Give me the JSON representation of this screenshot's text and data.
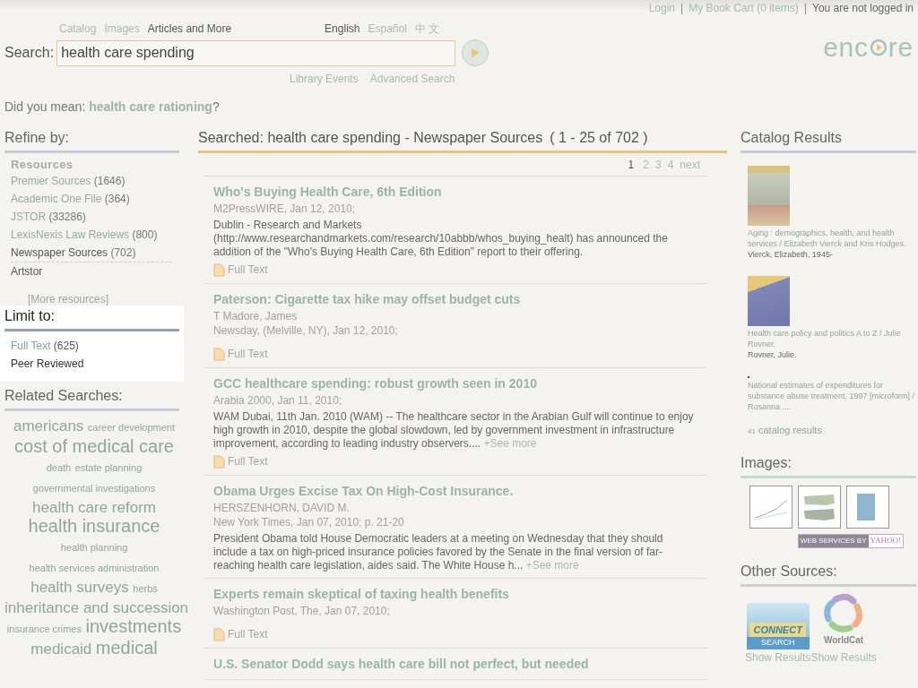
{
  "top_links": [
    {
      "label": "Login"
    },
    {
      "label": "My Book Cart (0 items)"
    }
  ],
  "separator": "|",
  "login_status": "You are not logged in",
  "logo": {
    "text_before": "enc",
    "text_after": "re"
  },
  "search_tabs": [
    {
      "label": "Catalog",
      "selected": false
    },
    {
      "label": "Images",
      "selected": false
    },
    {
      "label": "Articles and More",
      "selected": true
    }
  ],
  "languages": [
    {
      "label": "English",
      "selected": true
    },
    {
      "label": "Español",
      "selected": false
    },
    {
      "label": "中 文",
      "selected": false
    }
  ],
  "search": {
    "label": "Search:",
    "value": "health care spending"
  },
  "search_links": [
    "Library Events",
    "Advanced Search"
  ],
  "did_you_mean": {
    "prefix": "Did you mean:",
    "suggestion": "health care rationing",
    "suffix": "?"
  },
  "refine": {
    "title": "Refine by:",
    "group": "Resources",
    "items": [
      {
        "label": "Premier Sources",
        "count": "(1646)",
        "selected": false,
        "kind": "link"
      },
      {
        "label": "Academic One File",
        "count": "(364)",
        "selected": false,
        "kind": "link"
      },
      {
        "label": "JSTOR",
        "count": "(33286)",
        "selected": false,
        "kind": "link"
      },
      {
        "label": "LexisNexis Law Reviews",
        "count": "(800)",
        "selected": false,
        "kind": "link"
      },
      {
        "label": "Newspaper Sources",
        "count": "(702)",
        "selected": true,
        "kind": "link"
      },
      {
        "label": "Artstor",
        "selected": false,
        "kind": "plain"
      }
    ],
    "more": "[More resources]"
  },
  "limit": {
    "title": "Limit to:",
    "items": [
      {
        "label": "Full Text",
        "count": "(625)",
        "kind": "link"
      },
      {
        "label": "Peer Reviewed",
        "kind": "plain"
      }
    ]
  },
  "related": {
    "title": "Related Searches:",
    "tags": [
      {
        "label": "americans",
        "kind": "large"
      },
      {
        "label": "career development",
        "kind": "small"
      },
      {
        "label": "cost of medical care",
        "kind": "xlarge"
      },
      {
        "label": "death",
        "kind": "small"
      },
      {
        "label": "estate planning",
        "kind": "small"
      },
      {
        "label": "governmental investigations",
        "kind": "small"
      },
      {
        "label": "health care reform",
        "kind": "large"
      },
      {
        "label": "health insurance",
        "kind": "xlarge"
      },
      {
        "label": "health planning",
        "kind": "small"
      },
      {
        "label": "health services administration",
        "kind": "small"
      },
      {
        "label": "health surveys",
        "kind": "large"
      },
      {
        "label": "herbs",
        "kind": "small"
      },
      {
        "label": "inheritance and succession",
        "kind": "large"
      },
      {
        "label": "insurance crimes",
        "kind": "small"
      },
      {
        "label": "investments",
        "kind": "xlarge"
      },
      {
        "label": "medicaid",
        "kind": "large"
      },
      {
        "label": "medical",
        "kind": "xlarge"
      }
    ]
  },
  "results_header": {
    "title": "Searched: health care spending - Newspaper Sources",
    "range": "( 1 - 25 of 702 )"
  },
  "pages": [
    {
      "label": "1",
      "selected": true
    },
    {
      "label": "2",
      "selected": false
    },
    {
      "label": "3",
      "selected": false
    },
    {
      "label": "4",
      "selected": false
    },
    {
      "label": "next",
      "selected": false
    }
  ],
  "results": [
    {
      "title": "Who's Buying Health Care, 6th Edition",
      "meta": [
        "M2PressWIRE, Jan 12, 2010;"
      ],
      "snippet": "Dublin - Research and Markets (http://www.researchandmarkets.com/research/10abbb/whos_buying_healt) has announced the addition of the \"Who's Buying Health Care, 6th Edition\" report to their offering.",
      "full_text": "Full Text"
    },
    {
      "title": "Paterson: Cigarette tax hike may offset budget cuts",
      "meta": [
        "T Madore, James",
        "Newsday, (Melville, NY), Jan 12, 2010;"
      ],
      "full_text": "Full Text"
    },
    {
      "title": "GCC healthcare spending: robust growth seen in 2010",
      "meta": [
        "Arabia 2000, Jan 11, 2010;"
      ],
      "snippet": "WAM Dubai, 11th Jan. 2010 (WAM) -- The healthcare sector in the Arabian Gulf will continue to enjoy high growth in 2010, despite the global slowdown, led by government investment in infrastructure improvement, according to leading industry observers....",
      "see_more": "+See more",
      "full_text": "Full Text"
    },
    {
      "title": "Obama Urges Excise Tax On High-Cost Insurance.",
      "meta": [
        "HERSZENHORN, DAVID M.",
        "New York Times, Jan 07, 2010; p. 21-20"
      ],
      "snippet": "President Obama told House Democratic leaders at a meeting on Wednesday that they should include a tax on high-priced insurance policies favored by the Senate in the final version of far-reaching health care legislation, aides said. The White House h...",
      "see_more": "+See more"
    },
    {
      "title": "Experts remain skeptical of taxing health benefits",
      "meta": [
        "Washington Post, The, Jan 07, 2010;"
      ],
      "full_text": "Full Text"
    },
    {
      "title": "U.S. Senator Dodd says health care bill not perfect, but needed"
    }
  ],
  "catalog": {
    "title": "Catalog Results",
    "items": [
      {
        "kind": "photo",
        "title": "Aging : demographics, health, and health services / Elizabeth Vierck and Kris Hodges.",
        "author": "Vierck, Elizabeth, 1945-"
      },
      {
        "kind": "blue",
        "title": "Health care policy and politics A to Z / Julie Rovner.",
        "author": "Rovner, Julie."
      },
      {
        "kind": "none",
        "title": "National estimates of expenditures for substance abuse treatment, 1997 [microform] / Rosanna ...."
      }
    ],
    "count": "41",
    "count_label": "catalog results"
  },
  "images": {
    "title": "Images:",
    "thumbs": [
      {
        "kind": "line"
      },
      {
        "kind": "map"
      },
      {
        "kind": "bars"
      }
    ],
    "credit_prefix": "WEB SERVICES BY",
    "credit_brand": "YAHOO!"
  },
  "other": {
    "title": "Other Sources:",
    "sources": [
      {
        "kind": "connect",
        "logo_top": "CONNECT",
        "logo_bottom": "SEARCH",
        "link": "Show Results"
      },
      {
        "kind": "worldcat",
        "logo_top": "WorldCat",
        "link": "Show Results"
      }
    ]
  }
}
